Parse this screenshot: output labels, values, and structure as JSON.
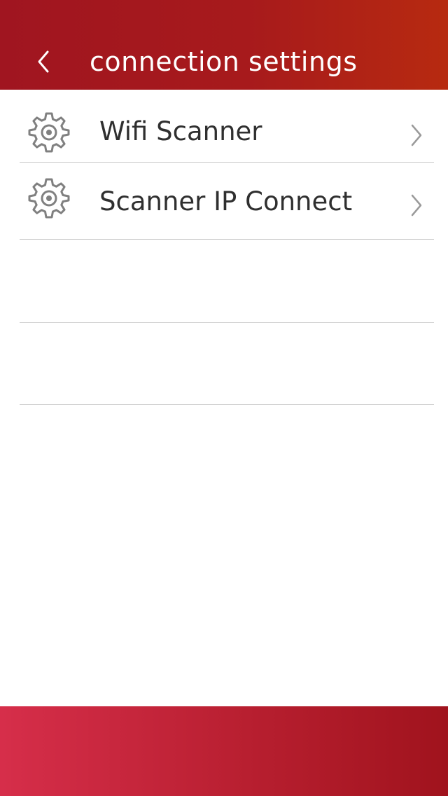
{
  "colors": {
    "header_start": "#a01520",
    "header_end": "#b72a10",
    "footer_start": "#d62e4a",
    "footer_end": "#a0131d",
    "text": "#2f2f2f",
    "icon": "#808080",
    "divider": "#c8c8c8"
  },
  "header": {
    "back_icon": "chevron-left-icon",
    "title": "connection settings"
  },
  "list": {
    "items": [
      {
        "icon": "gear-icon",
        "label": "Wifi Scanner",
        "trailing_icon": "chevron-right-icon"
      },
      {
        "icon": "gear-icon",
        "label": "Scanner IP Connect",
        "trailing_icon": "chevron-right-icon"
      }
    ]
  }
}
